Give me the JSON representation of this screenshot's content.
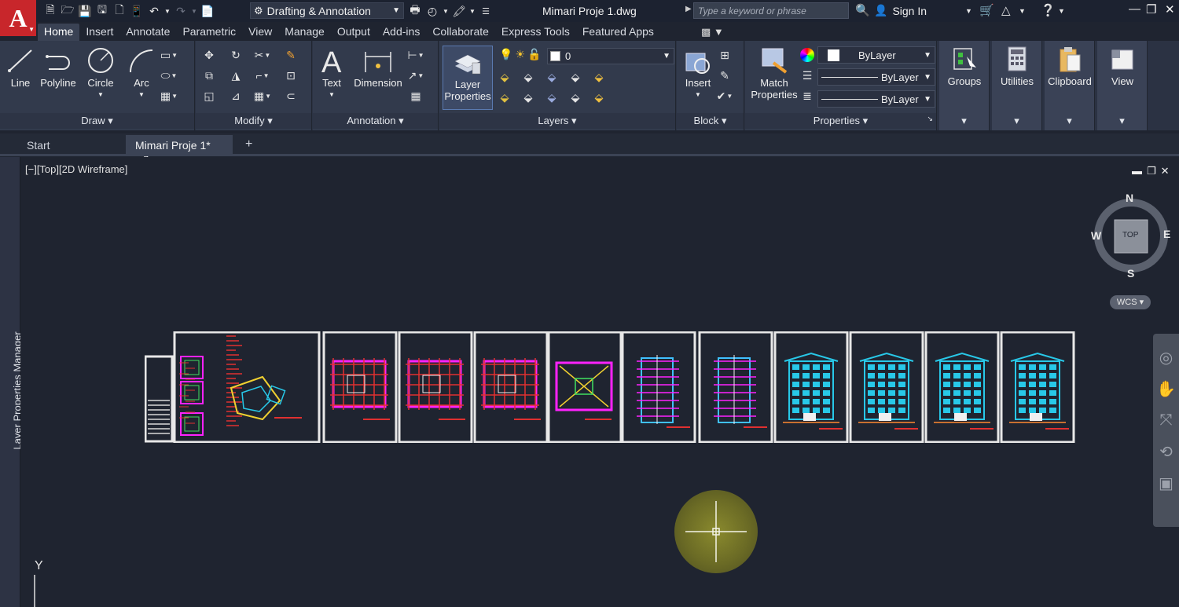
{
  "app": {
    "logo_letter": "A",
    "workspace": "Drafting & Annotation",
    "document_title": "Mimari Proje 1.dwg",
    "search_placeholder": "Type a keyword or phrase",
    "sign_in": "Sign In"
  },
  "ribbon_tabs": [
    "Home",
    "Insert",
    "Annotate",
    "Parametric",
    "View",
    "Manage",
    "Output",
    "Add-ins",
    "Collaborate",
    "Express Tools",
    "Featured Apps"
  ],
  "panels": {
    "draw": {
      "title": "Draw",
      "tools": [
        "Line",
        "Polyline",
        "Circle",
        "Arc"
      ]
    },
    "modify": {
      "title": "Modify"
    },
    "annotation": {
      "title": "Annotation",
      "text": "Text",
      "dimension": "Dimension"
    },
    "layers": {
      "title": "Layers",
      "layer_properties": "Layer\nProperties",
      "layer_line1": "Layer",
      "layer_line2": "Properties",
      "current_layer": "0"
    },
    "block": {
      "title": "Block",
      "insert": "Insert"
    },
    "properties": {
      "title": "Properties",
      "match_line1": "Match",
      "match_line2": "Properties",
      "color": "ByLayer",
      "linetype": "ByLayer",
      "lineweight": "ByLayer"
    },
    "groups": "Groups",
    "utilities": "Utilities",
    "clipboard": "Clipboard",
    "view": "View"
  },
  "file_tabs": {
    "start": "Start",
    "active": "Mimari Proje 1*"
  },
  "viewport": {
    "label": "[−][Top][2D Wireframe]",
    "compass": {
      "n": "N",
      "s": "S",
      "e": "E",
      "w": "W",
      "cube": "TOP"
    },
    "wcs": "WCS",
    "ucs_axis": "Y"
  },
  "palette": {
    "label": "Layer Properties Manager"
  },
  "colors": {
    "accent_red": "#c8262b",
    "background": "#1f2430",
    "ribbon": "#323a4c",
    "magenta": "#ff22ff",
    "cyan": "#28c8e8"
  }
}
